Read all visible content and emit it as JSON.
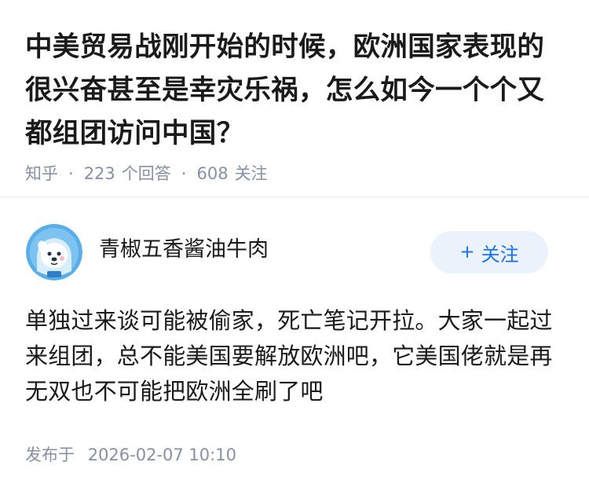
{
  "question": {
    "title": "中美贸易战刚开始的时候，欧洲国家表现的很兴奋甚至是幸灾乐祸，怎么如今一个个又都组团访问中国？",
    "source": "知乎",
    "answers_count": "223",
    "answers_label": "个回答",
    "followers_count": "608",
    "followers_label": "关注"
  },
  "answer": {
    "author": "青椒五香酱油牛肉",
    "follow_label": "关注",
    "content": "单独过来谈可能被偷家，死亡笔记开拉。大家一起过来组团，总不能美国要解放欧洲吧，它美国佬就是再无双也不可能把欧洲全刷了吧",
    "published_label": "发布于",
    "published_time": "2026-02-07 10:10"
  },
  "colors": {
    "title": "#1a1a1a",
    "meta": "#8590a6",
    "accent": "#1772f6",
    "button_bg": "#ebf2fb"
  },
  "icons": {
    "avatar": "avatar-blue-cartoon-dog"
  }
}
